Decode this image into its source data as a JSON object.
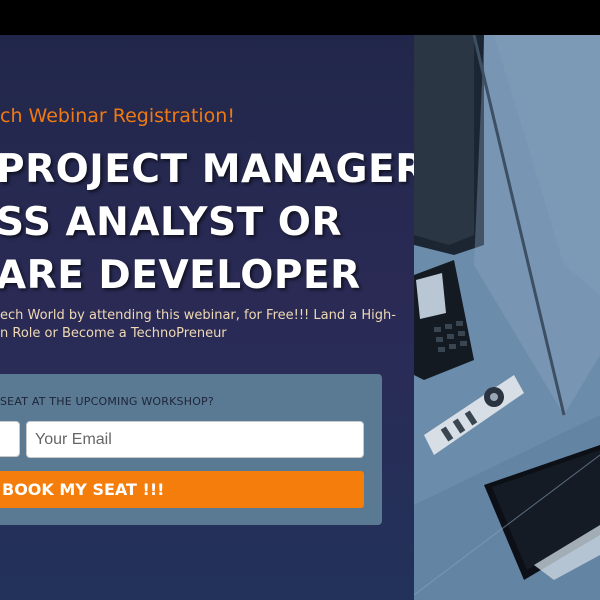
{
  "hero": {
    "subtitle": "ch Webinar Registration!",
    "headline_lines": [
      "PROJECT MANAGER,",
      "SS ANALYST OR",
      "ARE DEVELOPER"
    ],
    "lead_lines": [
      "ech World by attending this webinar, for Free!!! Land a High-",
      "n Role or Become a TechnoPreneur"
    ]
  },
  "form": {
    "title": "SEAT AT THE UPCOMING WORKSHOP?",
    "email_placeholder": "Your Email",
    "submit_label": "BOOK MY SEAT !!!"
  },
  "colors": {
    "accent_orange": "#f47d0b",
    "subtitle_orange": "#f07a12",
    "panel_navy": "#25294e",
    "form_card": "#5a7a94",
    "photo_tint": "#6a8aa8"
  },
  "photo": {
    "description_icons": [
      "laptop-icon",
      "desk-phone-icon",
      "remote-control-icon",
      "tablet-icon"
    ]
  }
}
